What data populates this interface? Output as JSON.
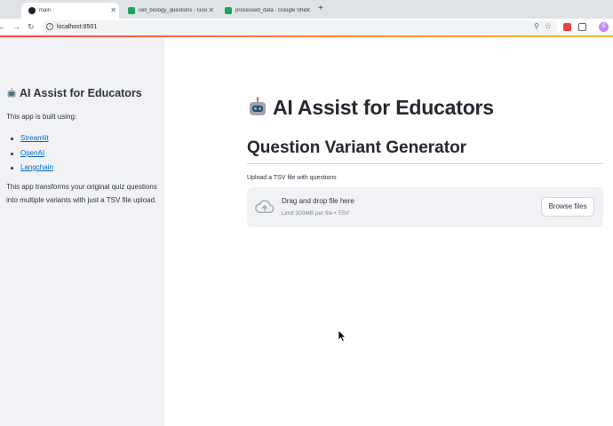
{
  "browser": {
    "tabs": [
      {
        "title": "main",
        "active": true,
        "icon": "streamlit-favicon"
      },
      {
        "title": "cell_biology_questions - Goo",
        "active": false,
        "icon": "google-sheets-favicon"
      },
      {
        "title": "processed_data - Google She",
        "active": false,
        "icon": "google-sheets-favicon"
      }
    ],
    "new_tab_label": "+",
    "url": "localhost:8501",
    "profile_initial": "S"
  },
  "sidebar": {
    "title": "AI Assist for Educators",
    "built_with": "This app is built using:",
    "links": [
      "Streamlit",
      "OpenAI",
      "Langchain"
    ],
    "description": "This app transforms your original quiz questions into multiple variants with just a TSV file upload."
  },
  "main": {
    "title": "AI Assist for Educators",
    "subtitle": "Question Variant Generator",
    "upload_label": "Upload a TSV file with questions",
    "dropzone": {
      "title": "Drag and drop file here",
      "limit": "Limit 200MB per file • TSV",
      "button": "Browse files"
    }
  },
  "colors": {
    "accent": "#ff4b4b",
    "link": "#0068c9",
    "sidebar_bg": "#f0f2f6"
  }
}
